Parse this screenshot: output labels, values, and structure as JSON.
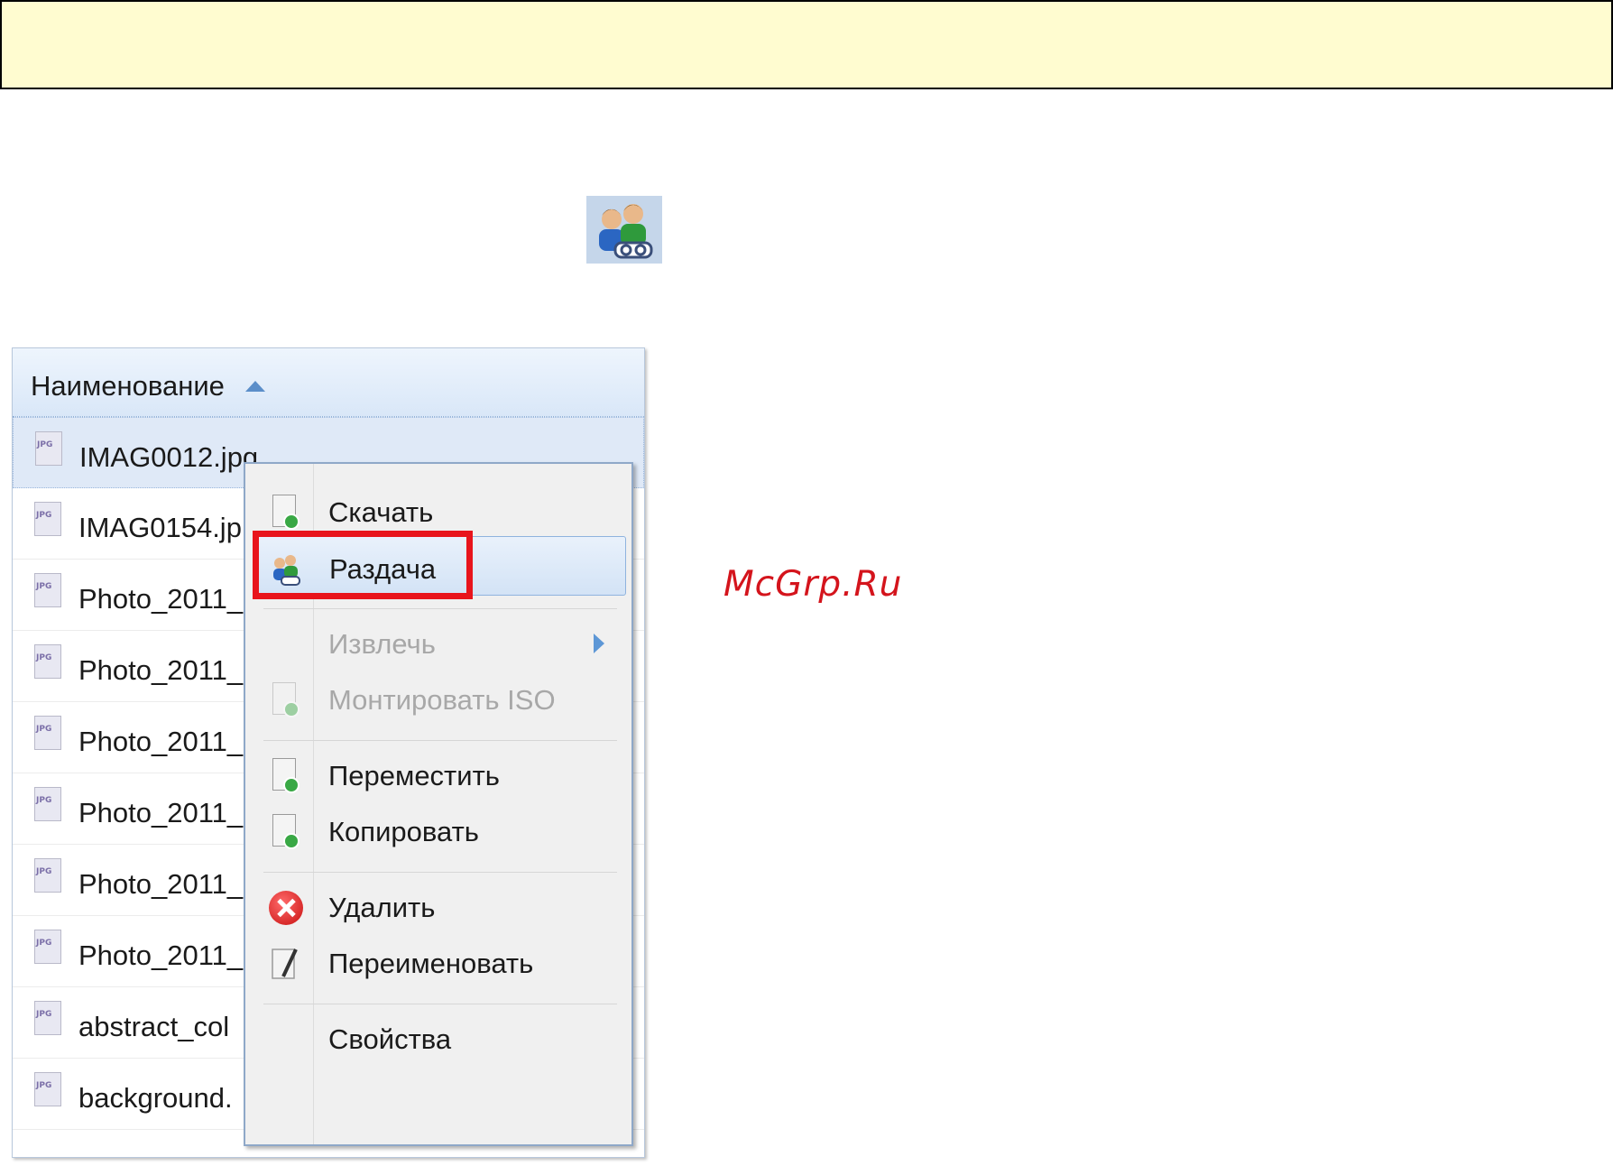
{
  "file_list": {
    "column_header": "Наименование",
    "rows": [
      {
        "name": "IMAG0012.jpg",
        "type": "JPG",
        "selected": true
      },
      {
        "name": "IMAG0154.jp",
        "type": "JPG"
      },
      {
        "name": "Photo_2011_",
        "type": "JPG"
      },
      {
        "name": "Photo_2011_",
        "type": "JPG"
      },
      {
        "name": "Photo_2011_",
        "type": "JPG"
      },
      {
        "name": "Photo_2011_",
        "type": "JPG"
      },
      {
        "name": "Photo_2011_",
        "type": "JPG"
      },
      {
        "name": "Photo_2011_",
        "type": "JPG"
      },
      {
        "name": "abstract_col",
        "type": "JPG"
      },
      {
        "name": "background.",
        "type": "JPG"
      }
    ]
  },
  "context_menu": {
    "items": [
      {
        "label": "Скачать",
        "icon": "download-icon",
        "enabled": true
      },
      {
        "label": "Раздача",
        "icon": "share-users-icon",
        "enabled": true,
        "hover": true
      },
      {
        "label": "Извлечь",
        "icon": "",
        "enabled": false,
        "submenu": true
      },
      {
        "label": "Монтировать ISO",
        "icon": "mount-iso-icon",
        "enabled": false
      },
      {
        "label": "Переместить",
        "icon": "move-icon",
        "enabled": true
      },
      {
        "label": "Копировать",
        "icon": "copy-icon",
        "enabled": true
      },
      {
        "label": "Удалить",
        "icon": "delete-icon",
        "enabled": true
      },
      {
        "label": "Переименовать",
        "icon": "rename-icon",
        "enabled": true
      },
      {
        "label": "Свойства",
        "icon": "",
        "enabled": true
      }
    ]
  },
  "colors": {
    "banner": "#fffcd0",
    "highlight": "#e8141c",
    "watermark": "#d4141c"
  },
  "watermark": "McGrp.Ru"
}
